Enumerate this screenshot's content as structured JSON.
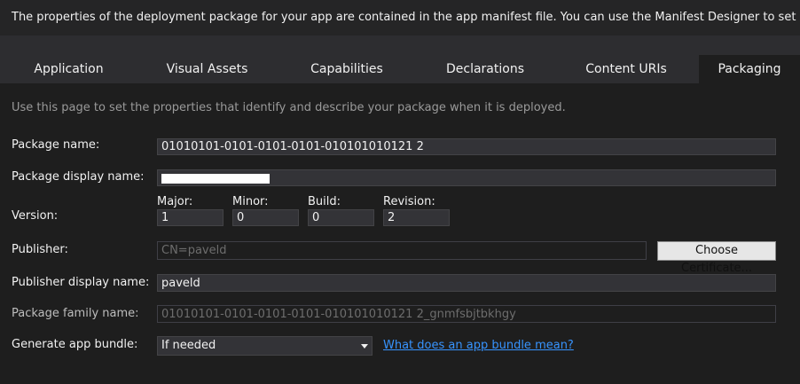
{
  "header": {
    "description": "The properties of the deployment package for your app are contained in the app manifest file. You can use the Manifest Designer to set or m"
  },
  "tabs": [
    {
      "label": "Application"
    },
    {
      "label": "Visual Assets"
    },
    {
      "label": "Capabilities"
    },
    {
      "label": "Declarations"
    },
    {
      "label": "Content URIs"
    },
    {
      "label": "Packaging",
      "active": true
    }
  ],
  "packaging": {
    "hint": "Use this page to set the properties that identify and describe your package when it is deployed.",
    "package_name_label": "Package name:",
    "package_name": "01010101-0101-0101-0101-010101010121 2",
    "package_display_name_label": "Package display name:",
    "package_display_name": "",
    "version_label": "Version:",
    "version": {
      "major_label": "Major:",
      "major": "1",
      "minor_label": "Minor:",
      "minor": "0",
      "build_label": "Build:",
      "build": "0",
      "revision_label": "Revision:",
      "revision": "2"
    },
    "publisher_label": "Publisher:",
    "publisher": "CN=paveld",
    "choose_certificate_label": "Choose Certificate...",
    "publisher_display_name_label": "Publisher display name:",
    "publisher_display_name": "paveld",
    "package_family_name_label": "Package family name:",
    "package_family_name": "01010101-0101-0101-0101-010101010121 2_gnmfsbjtbkhgy",
    "generate_bundle_label": "Generate app bundle:",
    "generate_bundle_value": "If needed",
    "bundle_help_link": "What does an app bundle mean?"
  },
  "colors": {
    "background": "#2d2d30",
    "panel": "#1e1e1e",
    "link": "#3794ff"
  }
}
